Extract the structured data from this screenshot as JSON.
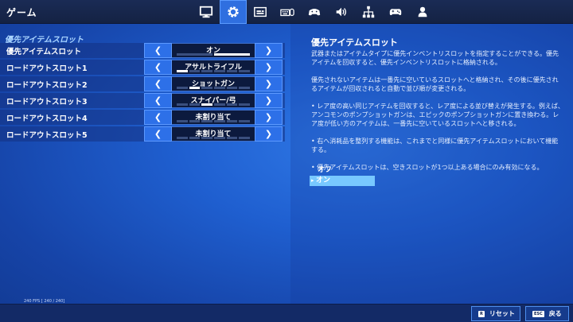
{
  "header": {
    "title": "ゲーム",
    "tabs": [
      {
        "name": "monitor-icon",
        "active": false
      },
      {
        "name": "gear-icon",
        "active": true
      },
      {
        "name": "subtitles-icon",
        "active": false
      },
      {
        "name": "keyboard-mouse-icon",
        "active": false
      },
      {
        "name": "controller-settings-icon",
        "active": false
      },
      {
        "name": "speaker-icon",
        "active": false
      },
      {
        "name": "network-icon",
        "active": false
      },
      {
        "name": "gamepad-icon",
        "active": false
      },
      {
        "name": "account-icon",
        "active": false
      }
    ]
  },
  "settings": {
    "section_title": "優先アイテムスロット",
    "rows": [
      {
        "label": "優先アイテムスロット",
        "value": "オン",
        "segments": 2,
        "selected": 2
      },
      {
        "label": "ロードアウトスロット1",
        "value": "アサルトライフル",
        "segments": 6,
        "selected": 1
      },
      {
        "label": "ロードアウトスロット2",
        "value": "ショットガン",
        "segments": 6,
        "selected": 2
      },
      {
        "label": "ロードアウトスロット3",
        "value": "スナイパー/弓",
        "segments": 6,
        "selected": 3
      },
      {
        "label": "ロードアウトスロット4",
        "value": "未割り当て",
        "segments": 6,
        "selected": 0
      },
      {
        "label": "ロードアウトスロット5",
        "value": "未割り当て",
        "segments": 6,
        "selected": 0
      }
    ],
    "fps": "240 FPS [ 240 / 240]"
  },
  "description": {
    "title": "優先アイテムスロット",
    "paragraphs": [
      "武器またはアイテムタイプに優先インベントリスロットを指定することができる。優先アイテムを回収すると、優先インベントリスロットに格納される。",
      "優先されないアイテムは一番先に空いているスロットへと格納され、その後に優先されるアイテムが回収されると自動で並び順が変更される。",
      "• レア度の高い同じアイテムを回収すると、レア度による並び替えが発生する。例えば、アンコモンのポンプショットガンは、エピックのポンプショットガンに置き換わる。レア度が低い方のアイテムは、一番先に空いているスロットへと移される。",
      "• 右へ消耗品を整列する機能は、これまでと同様に優先アイテムスロットにおいて機能する。",
      "• 優先アイテムスロットは、空きスロットが1つ以上ある場合にのみ有効になる。"
    ],
    "options": [
      "オフ",
      "オン"
    ],
    "selected_option": 1
  },
  "footer": {
    "reset_key": "R",
    "reset_label": "リセット",
    "back_key": "ESC",
    "back_label": "戻る"
  }
}
